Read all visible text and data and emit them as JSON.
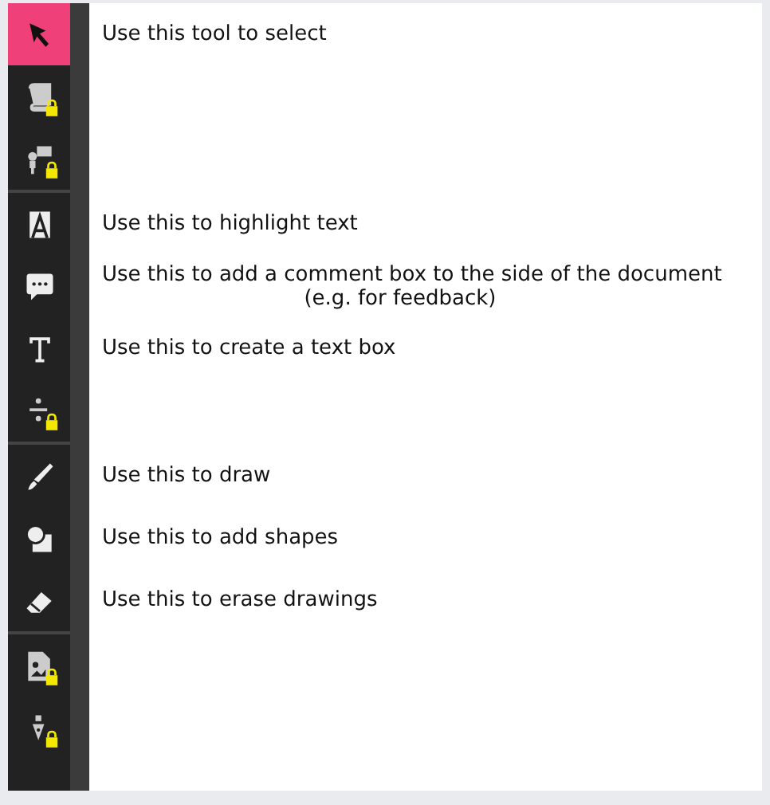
{
  "tool_groups": [
    {
      "tools": [
        {
          "kind": "select",
          "selected": true,
          "locked": false,
          "description": "Use this tool to select"
        },
        {
          "kind": "book",
          "selected": false,
          "locked": true
        },
        {
          "kind": "presenter",
          "selected": false,
          "locked": true
        }
      ]
    },
    {
      "tools": [
        {
          "kind": "highlight",
          "selected": false,
          "locked": false,
          "description": "Use this to highlight text"
        },
        {
          "kind": "comment",
          "selected": false,
          "locked": false,
          "description": "Use this to add a comment box to the side of the document",
          "note": "(e.g. for feedback)"
        },
        {
          "kind": "text",
          "selected": false,
          "locked": false,
          "description": "Use this to create a text box"
        },
        {
          "kind": "divide",
          "selected": false,
          "locked": true
        }
      ]
    },
    {
      "tools": [
        {
          "kind": "pen",
          "selected": false,
          "locked": false,
          "description": "Use this to draw"
        },
        {
          "kind": "shapes",
          "selected": false,
          "locked": false,
          "description": "Use this to add shapes"
        },
        {
          "kind": "eraser",
          "selected": false,
          "locked": false,
          "description": "Use this to erase drawings"
        }
      ]
    },
    {
      "tools": [
        {
          "kind": "image",
          "selected": false,
          "locked": true
        },
        {
          "kind": "nib",
          "selected": false,
          "locked": true
        }
      ]
    }
  ]
}
